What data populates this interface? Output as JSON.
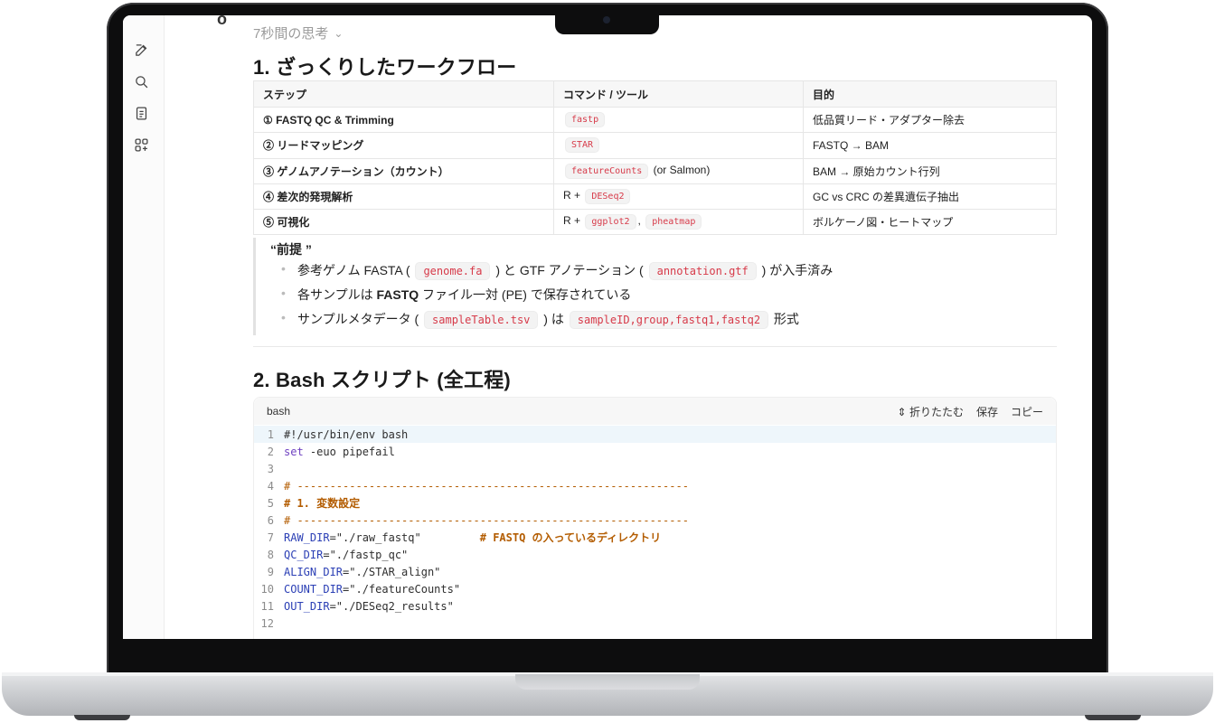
{
  "sidebar": {
    "icons": [
      "edit-icon",
      "search-icon",
      "document-icon",
      "apps-add-icon"
    ]
  },
  "header": {
    "logo_stub": "o",
    "thinking_label": "7秒間の思考"
  },
  "section1": {
    "title": "1. ざっくりしたワークフロー",
    "headers": [
      "ステップ",
      "コマンド / ツール",
      "目的"
    ],
    "rows": [
      {
        "step": "① FASTQ QC & Trimming",
        "tools": [
          {
            "code": "fastp"
          }
        ],
        "suffix": "",
        "purpose": "低品質リード・アダプター除去"
      },
      {
        "step": "② リードマッピング",
        "tools": [
          {
            "code": "STAR"
          }
        ],
        "suffix": "",
        "purpose": "FASTQ → BAM"
      },
      {
        "step": "③ ゲノムアノテーション（カウント）",
        "tools": [
          {
            "code": "featureCounts"
          }
        ],
        "suffix": "(or Salmon)",
        "purpose": "BAM → 原始カウント行列"
      },
      {
        "step": "④ 差次的発現解析",
        "prefix": "R +",
        "tools": [
          {
            "code": "DESeq2"
          }
        ],
        "suffix": "",
        "purpose": "GC vs CRC の差異遺伝子抽出"
      },
      {
        "step": "⑤ 可視化",
        "prefix": "R +",
        "tools": [
          {
            "code": "ggplot2"
          },
          {
            "code": "pheatmap"
          }
        ],
        "separator": ",",
        "purpose": "ボルケーノ図・ヒートマップ"
      }
    ]
  },
  "premise": {
    "title": "“前提 ”",
    "items": {
      "a_pre": "参考ゲノム FASTA (",
      "a_code1": "genome.fa",
      "a_mid": ") と GTF アノテーション (",
      "a_code2": "annotation.gtf",
      "a_post": ") が入手済み",
      "b_pre": "各サンプルは ",
      "b_bold": "FASTQ",
      "b_post": " ファイル一対 (PE) で保存されている",
      "c_pre": "サンプルメタデータ (",
      "c_code1": "sampleTable.tsv",
      "c_mid": ") は",
      "c_code2": "sampleID,group,fastq1,fastq2",
      "c_post": " 形式"
    }
  },
  "section2": {
    "title": "2. Bash スクリプト (全工程)"
  },
  "codeblock": {
    "language": "bash",
    "fold_label": "折りたたむ",
    "save_label": "保存",
    "copy_label": "コピー",
    "lines": [
      {
        "n": "1",
        "text": "#!/usr/bin/env bash"
      },
      {
        "n": "2",
        "kw": "set",
        "text": " -euo pipefail"
      },
      {
        "n": "3",
        "text": ""
      },
      {
        "n": "4",
        "text": "# ------------------------------------------------------------"
      },
      {
        "n": "5",
        "text": "# 1. 変数設定"
      },
      {
        "n": "6",
        "text": "# ------------------------------------------------------------"
      },
      {
        "n": "7",
        "var": "RAW_DIR",
        "text": "=\"./raw_fastq\"",
        "comment": "         # FASTQ の入っているディレクトリ"
      },
      {
        "n": "8",
        "var": "QC_DIR",
        "text": "=\"./fastp_qc\""
      },
      {
        "n": "9",
        "var": "ALIGN_DIR",
        "text": "=\"./STAR_align\""
      },
      {
        "n": "10",
        "var": "COUNT_DIR",
        "text": "=\"./featureCounts\""
      },
      {
        "n": "11",
        "var": "OUT_DIR",
        "text": "=\"./DESeq2_results\""
      },
      {
        "n": "12",
        "text": ""
      }
    ]
  }
}
